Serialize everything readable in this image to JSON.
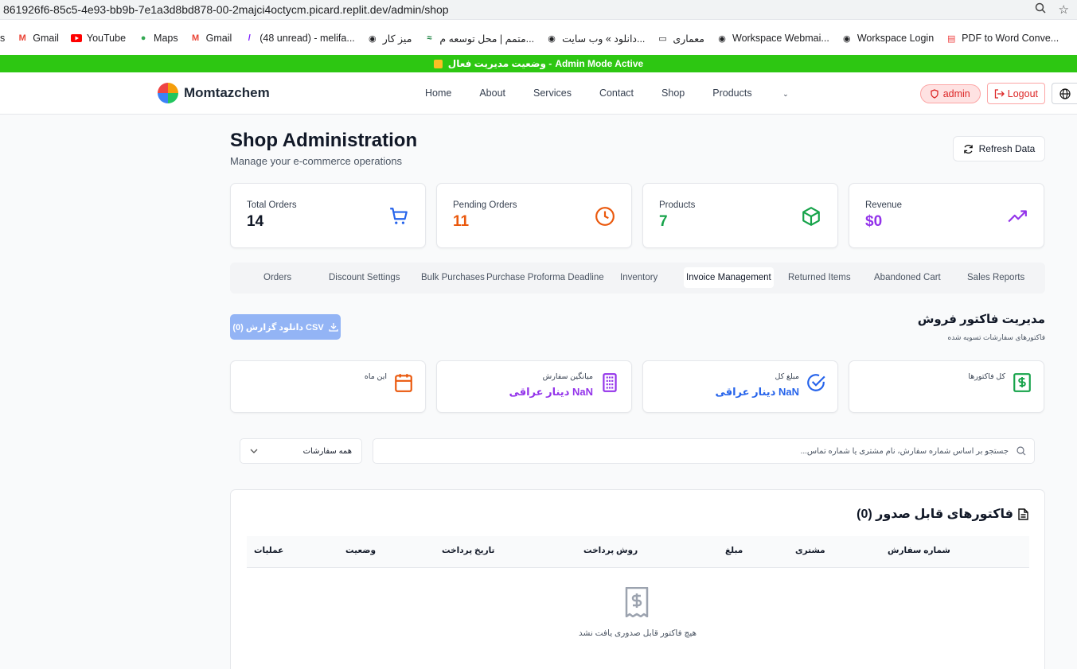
{
  "browser": {
    "url": "861926f6-85c5-4e93-bb9b-7e1a3d8bd878-00-2majci4octycm.picard.replit.dev/admin/shop",
    "bookmarks": [
      "s",
      "Gmail",
      "YouTube",
      "Maps",
      "Gmail",
      "(48 unread) - melifa...",
      "میز کار",
      "متمم | محل توسعه م...",
      "دانلود » وب سایت...",
      "معماری",
      "Workspace Webmai...",
      "Workspace Login",
      "PDF to Word Conve..."
    ]
  },
  "admin_bar": {
    "text": "Admin Mode Active",
    "prefix": "وضعیت مدیریت فعال -"
  },
  "navbar": {
    "brand": "Momtazchem",
    "links": [
      "Home",
      "About",
      "Services",
      "Contact",
      "Shop",
      "Products"
    ],
    "user": "admin",
    "logout": "Logout"
  },
  "header": {
    "title": "Shop Administration",
    "subtitle": "Manage your e-commerce operations",
    "refresh": "Refresh Data"
  },
  "stats": [
    {
      "label": "Total Orders",
      "value": "14",
      "color": "#111827",
      "icon": "cart-icon",
      "icon_color": "#2563eb"
    },
    {
      "label": "Pending Orders",
      "value": "11",
      "color": "#ea580c",
      "icon": "clock-icon",
      "icon_color": "#ea580c"
    },
    {
      "label": "Products",
      "value": "7",
      "color": "#16a34a",
      "icon": "box-icon",
      "icon_color": "#16a34a"
    },
    {
      "label": "Revenue",
      "value": "$0",
      "color": "#9333ea",
      "icon": "trending-up-icon",
      "icon_color": "#9333ea"
    }
  ],
  "tabs": [
    "Orders",
    "Discount Settings",
    "Bulk Purchases",
    "Purchase Proforma Deadline",
    "Inventory",
    "Invoice Management",
    "Returned Items",
    "Abandoned Cart",
    "Sales Reports"
  ],
  "active_tab": "Invoice Management",
  "invoice": {
    "title": "مدیریت فاکتور فروش",
    "subtitle": "فاکتورهای سفارشات تسویه شده",
    "csv_button": "دانلود گزارش (0) CSV",
    "cards": [
      {
        "label": "کل فاکتورها",
        "value": "",
        "icon": "dollar-file-icon",
        "icon_color": "#16a34a"
      },
      {
        "label": "مبلغ کل",
        "value": "NaN دینار عراقی",
        "value_color": "#2563eb",
        "icon": "check-circle-icon",
        "icon_color": "#2563eb"
      },
      {
        "label": "میانگین سفارش",
        "value": "NaN دینار عراقی",
        "value_color": "#9333ea",
        "icon": "building-icon",
        "icon_color": "#9333ea"
      },
      {
        "label": "این ماه",
        "value": "",
        "icon": "calendar-icon",
        "icon_color": "#ea580c"
      }
    ],
    "filter_select": "همه سفارشات",
    "search_placeholder": "جستجو بر اساس شماره سفارش، نام مشتری یا شماره تماس...",
    "table_title": "فاکتورهای قابل صدور (0)",
    "columns": [
      "شماره سفارش",
      "مشتری",
      "مبلغ",
      "روش پرداخت",
      "تاریخ پرداخت",
      "وضعیت",
      "عملیات"
    ],
    "empty_text": "هیچ فاکتور قابل صدوری یافت نشد"
  }
}
